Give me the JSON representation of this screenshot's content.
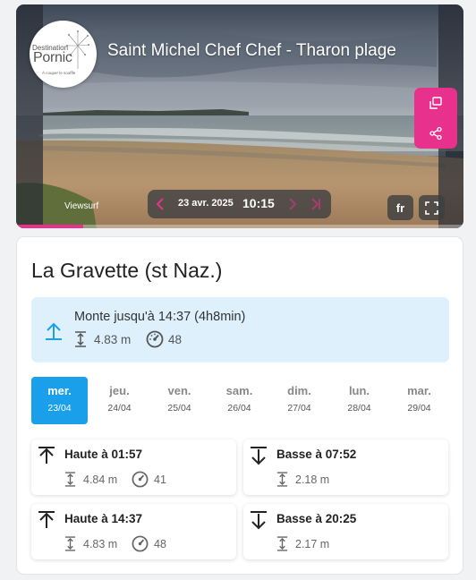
{
  "webcam": {
    "title": "Saint Michel Chef Chef - Tharon plage",
    "logo": {
      "line1": "Destination",
      "line2": "Pornic",
      "tagline": "À couper le souffle"
    },
    "credit": "Viewsurf",
    "date": "23 avr. 2025",
    "time": "10:15",
    "language": "fr",
    "accent_color": "#e8318c"
  },
  "tide": {
    "location": "La Gravette (st Naz.)",
    "current": {
      "status": "Monte jusqu'à 14:37 (4h8min)",
      "height": "4.83 m",
      "coefficient": "48"
    },
    "days": [
      {
        "name": "mer.",
        "date": "23/04",
        "selected": true
      },
      {
        "name": "jeu.",
        "date": "24/04",
        "selected": false
      },
      {
        "name": "ven.",
        "date": "25/04",
        "selected": false
      },
      {
        "name": "sam.",
        "date": "26/04",
        "selected": false
      },
      {
        "name": "dim.",
        "date": "27/04",
        "selected": false
      },
      {
        "name": "lun.",
        "date": "28/04",
        "selected": false
      },
      {
        "name": "mar.",
        "date": "29/04",
        "selected": false
      }
    ],
    "tides": [
      {
        "type": "high",
        "label": "Haute à 01:57",
        "height": "4.84 m",
        "coefficient": "41"
      },
      {
        "type": "low",
        "label": "Basse à 07:52",
        "height": "2.18 m",
        "coefficient": ""
      },
      {
        "type": "high",
        "label": "Haute à 14:37",
        "height": "4.83 m",
        "coefficient": "48"
      },
      {
        "type": "low",
        "label": "Basse à 20:25",
        "height": "2.17 m",
        "coefficient": ""
      }
    ],
    "selected_color": "#1a9fea",
    "current_bg_color": "#ddf0fb"
  }
}
